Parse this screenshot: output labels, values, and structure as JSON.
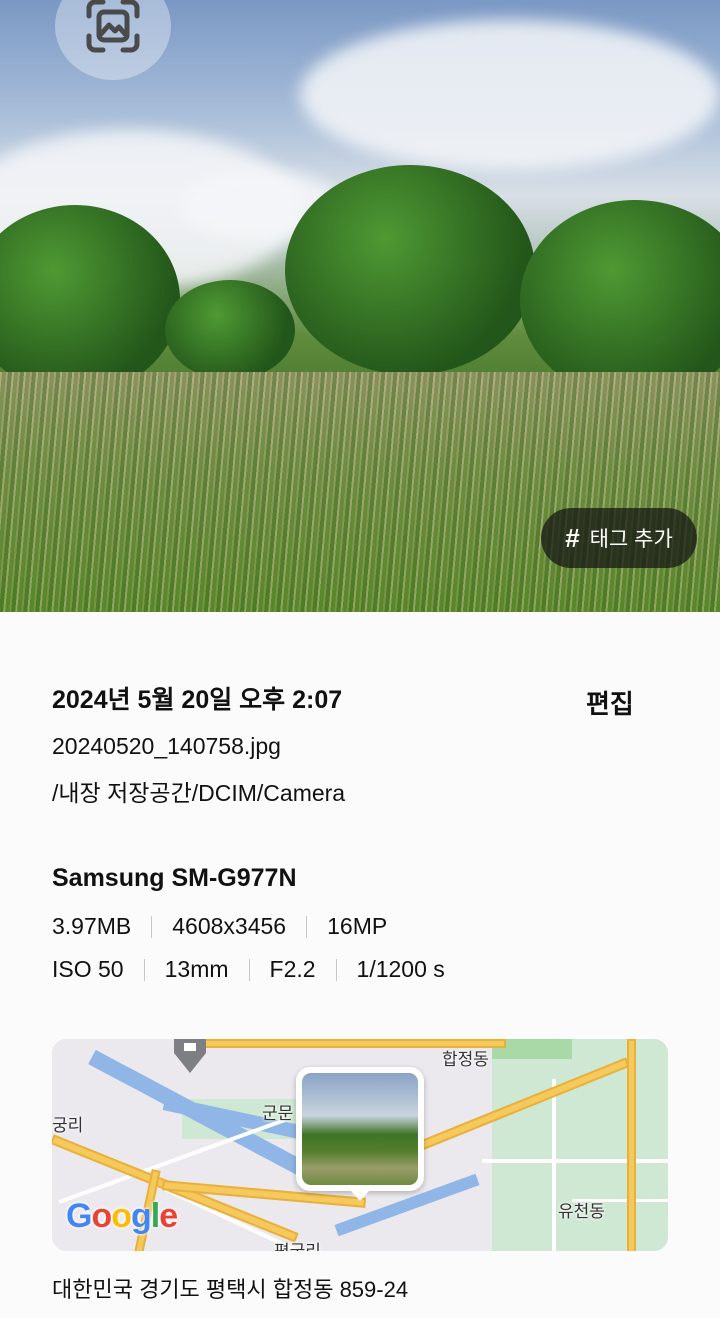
{
  "photo": {
    "tag_button_label": "태그 추가",
    "tag_button_symbol": "#",
    "lens_icon": "image-scan-icon"
  },
  "details": {
    "datetime": "2024년 5월 20일 오후 2:07",
    "edit_label": "편집",
    "filename": "20240520_140758.jpg",
    "path": "/내장 저장공간/DCIM/Camera"
  },
  "camera": {
    "device": "Samsung SM-G977N",
    "row1": [
      "3.97MB",
      "4608x3456",
      "16MP"
    ],
    "row2": [
      "ISO 50",
      "13mm",
      "F2.2",
      "1/1200 s"
    ]
  },
  "map": {
    "labels": [
      "합정동",
      "군문",
      "궁리",
      "유천동",
      "평궁리"
    ],
    "google_letters": [
      "G",
      "o",
      "o",
      "g",
      "l",
      "e"
    ],
    "google_colors": [
      "#4285F4",
      "#EA4335",
      "#FBBC05",
      "#4285F4",
      "#34A853",
      "#EA4335"
    ]
  },
  "location": {
    "address": "대한민국 경기도 평택시 합정동 859-24"
  }
}
